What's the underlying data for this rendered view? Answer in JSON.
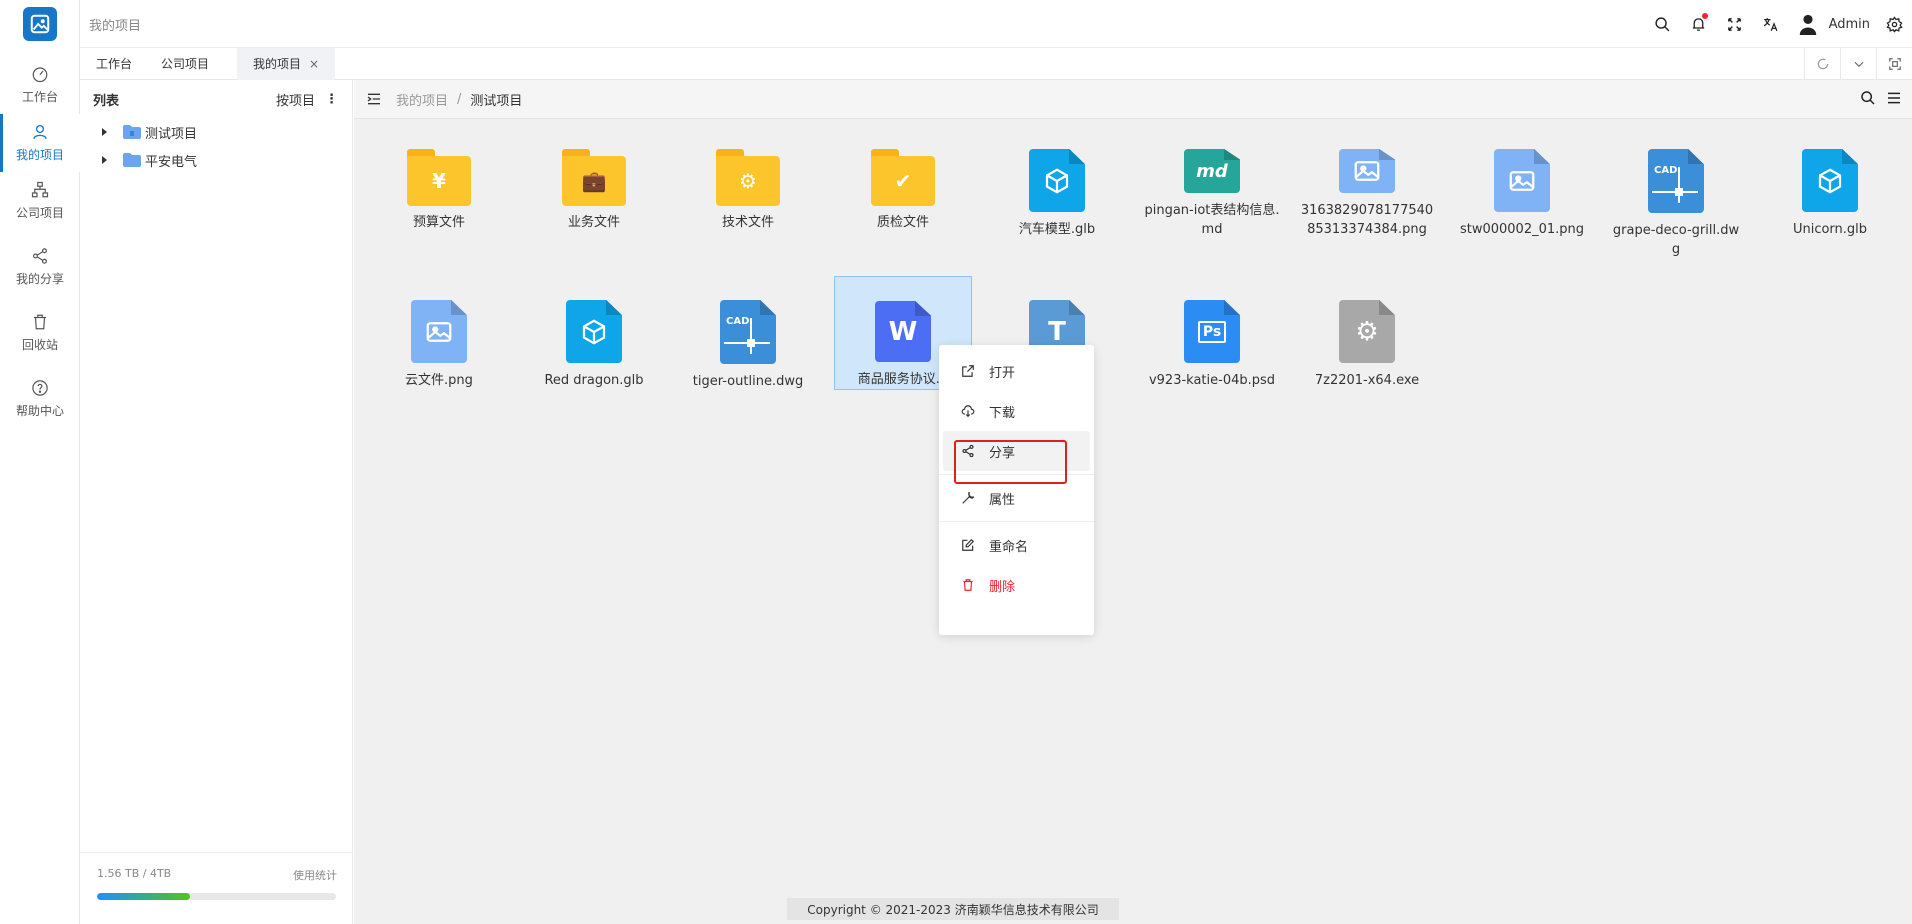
{
  "app": {
    "header_title": "我的项目",
    "user_name": "Admin"
  },
  "sidebar": {
    "items": [
      {
        "label": "工作台",
        "icon": "dashboard-icon"
      },
      {
        "label": "我的项目",
        "icon": "user-icon"
      },
      {
        "label": "公司项目",
        "icon": "org-icon"
      },
      {
        "label": "我的分享",
        "icon": "share-icon"
      },
      {
        "label": "回收站",
        "icon": "trash-icon"
      },
      {
        "label": "帮助中心",
        "icon": "help-icon"
      }
    ],
    "active_index": 1
  },
  "tabs": [
    {
      "label": "工作台"
    },
    {
      "label": "公司项目"
    },
    {
      "label": "我的项目",
      "close": "×"
    }
  ],
  "tree": {
    "title": "列表",
    "sort_label": "按项目",
    "more": "⋮",
    "nodes": [
      {
        "label": "测试项目"
      },
      {
        "label": "平安电气"
      }
    ]
  },
  "storage": {
    "usage": "1.56 TB / 4TB",
    "stats_label": "使用统计",
    "used_fraction": 0.39
  },
  "breadcrumb": {
    "parent": "我的项目",
    "separator": "/",
    "current": "测试项目"
  },
  "files": [
    {
      "name": "预算文件",
      "type": "folder",
      "sym": "¥"
    },
    {
      "name": "业务文件",
      "type": "folder",
      "sym": "💼"
    },
    {
      "name": "技术文件",
      "type": "folder",
      "sym": "⚙"
    },
    {
      "name": "质检文件",
      "type": "folder",
      "sym": "✔"
    },
    {
      "name": "汽车模型.glb",
      "type": "glb",
      "color": "#0ea5e9"
    },
    {
      "name": "pingan-iot表结构信息.md",
      "type": "md",
      "color": "#26a69a",
      "lbl": "md"
    },
    {
      "name": "3163829078177540 85313374384.png",
      "type": "img",
      "color": "#7fb3f5"
    },
    {
      "name": "stw000002_01.png",
      "type": "img",
      "color": "#7fb3f5"
    },
    {
      "name": "grape-deco-grill.dw g",
      "type": "cad",
      "color": "#3b8fd8",
      "lbl": "CAD"
    },
    {
      "name": "Unicorn.glb",
      "type": "glb",
      "color": "#0ea5e9"
    },
    {
      "name": "云文件.png",
      "type": "img",
      "color": "#7fb3f5"
    },
    {
      "name": "Red dragon.glb",
      "type": "glb",
      "color": "#0ea5e9"
    },
    {
      "name": "tiger-outline.dwg",
      "type": "cad",
      "color": "#3b8fd8",
      "lbl": "CAD"
    },
    {
      "name": "商品服务协议.d",
      "type": "word",
      "color": "#4c6ef5",
      "lbl": "W"
    },
    {
      "name": "",
      "type": "txt",
      "color": "#5b9bd5",
      "lbl": "T"
    },
    {
      "name": "v923-katie-04b.psd",
      "type": "psd",
      "color": "#2b8cf3",
      "lbl": "Ps"
    },
    {
      "name": "7z2201-x64.exe",
      "type": "exe",
      "color": "#a8a8a8",
      "lbl": "⚙"
    }
  ],
  "context_menu": {
    "items": [
      {
        "label": "打开",
        "icon": "open-external-icon"
      },
      {
        "label": "下载",
        "icon": "cloud-download-icon"
      },
      {
        "label": "分享",
        "icon": "share-icon"
      },
      {
        "label": "属性",
        "icon": "wrench-icon"
      },
      {
        "label": "重命名",
        "icon": "edit-icon"
      },
      {
        "label": "删除",
        "icon": "delete-icon"
      }
    ]
  },
  "footer": {
    "copyright": "Copyright © 2021-2023 济南颖华信息技术有限公司"
  },
  "colors": {
    "accent": "#1677c9",
    "danger": "#f5222d",
    "folder": "#fcc52b"
  }
}
